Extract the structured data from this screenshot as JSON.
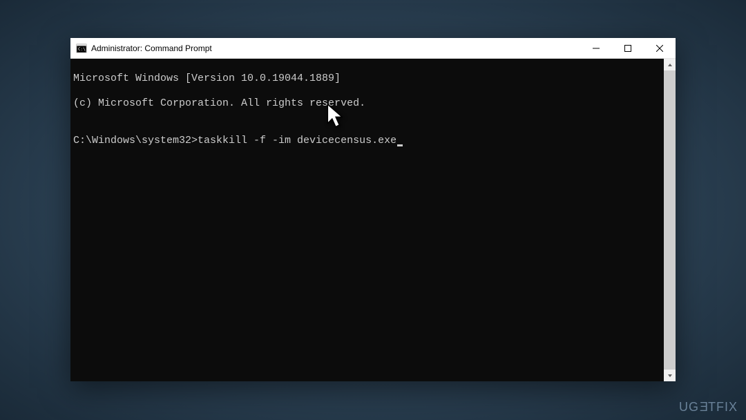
{
  "window": {
    "title": "Administrator: Command Prompt"
  },
  "terminal": {
    "line1": "Microsoft Windows [Version 10.0.19044.1889]",
    "line2": "(c) Microsoft Corporation. All rights reserved.",
    "blank": "",
    "prompt": "C:\\Windows\\system32>",
    "command": "taskkill -f -im devicecensus.exe"
  },
  "watermark": {
    "part1": "UG",
    "part2": "E",
    "part3": "TFIX"
  }
}
